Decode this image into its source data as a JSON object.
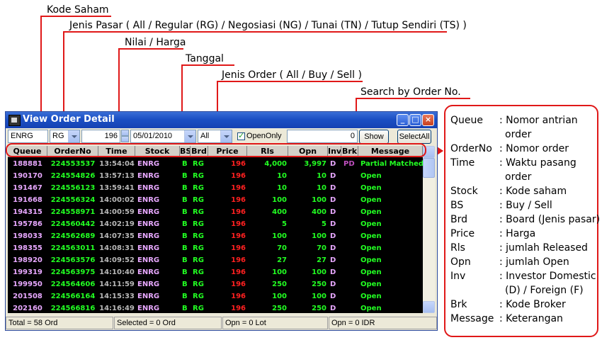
{
  "annotations": {
    "kode_saham": "Kode Saham",
    "jenis_pasar": "Jenis Pasar ( All / Regular (RG) / Negosiasi (NG) / Tunai (TN) / Tutup Sendiri (TS) )",
    "nilai_harga": "Nilai / Harga",
    "tanggal": "Tanggal",
    "jenis_order": "Jenis Order ( All / Buy / Sell )",
    "search_by_order": "Search by Order No."
  },
  "window": {
    "title": "View Order Detail",
    "minimize": "_",
    "maximize": "□",
    "close": "×"
  },
  "toolbar": {
    "stock_value": "ENRG",
    "market_value": "RG",
    "price_value": "196",
    "date_value": "05/01/2010",
    "order_type_value": "All",
    "open_only_label": "OpenOnly",
    "open_only_checked": true,
    "order_no_value": "0",
    "show_label": "Show",
    "select_all_label": "SelectAll"
  },
  "grid": {
    "columns": [
      "Queue",
      "OrderNo",
      "Time",
      "Stock",
      "BS",
      "Brd",
      "Price",
      "Rls",
      "Opn",
      "Inv",
      "Brk",
      "Message"
    ],
    "rows": [
      {
        "queue": "188881",
        "order_no": "224553537",
        "time": "13:54:04",
        "stock": "ENRG",
        "bs": "B",
        "brd": "RG",
        "price": "196",
        "rls": "4,000",
        "opn": "3,997",
        "inv": "D",
        "brk": "PD",
        "message": "Partial Matched"
      },
      {
        "queue": "190170",
        "order_no": "224554826",
        "time": "13:57:13",
        "stock": "ENRG",
        "bs": "B",
        "brd": "RG",
        "price": "196",
        "rls": "10",
        "opn": "10",
        "inv": "D",
        "brk": "",
        "message": "Open"
      },
      {
        "queue": "191467",
        "order_no": "224556123",
        "time": "13:59:41",
        "stock": "ENRG",
        "bs": "B",
        "brd": "RG",
        "price": "196",
        "rls": "10",
        "opn": "10",
        "inv": "D",
        "brk": "",
        "message": "Open"
      },
      {
        "queue": "191668",
        "order_no": "224556324",
        "time": "14:00:02",
        "stock": "ENRG",
        "bs": "B",
        "brd": "RG",
        "price": "196",
        "rls": "100",
        "opn": "100",
        "inv": "D",
        "brk": "",
        "message": "Open"
      },
      {
        "queue": "194315",
        "order_no": "224558971",
        "time": "14:00:59",
        "stock": "ENRG",
        "bs": "B",
        "brd": "RG",
        "price": "196",
        "rls": "400",
        "opn": "400",
        "inv": "D",
        "brk": "",
        "message": "Open"
      },
      {
        "queue": "195786",
        "order_no": "224560442",
        "time": "14:02:19",
        "stock": "ENRG",
        "bs": "B",
        "brd": "RG",
        "price": "196",
        "rls": "5",
        "opn": "5",
        "inv": "D",
        "brk": "",
        "message": "Open"
      },
      {
        "queue": "198033",
        "order_no": "224562689",
        "time": "14:07:35",
        "stock": "ENRG",
        "bs": "B",
        "brd": "RG",
        "price": "196",
        "rls": "100",
        "opn": "100",
        "inv": "D",
        "brk": "",
        "message": "Open"
      },
      {
        "queue": "198355",
        "order_no": "224563011",
        "time": "14:08:31",
        "stock": "ENRG",
        "bs": "B",
        "brd": "RG",
        "price": "196",
        "rls": "70",
        "opn": "70",
        "inv": "D",
        "brk": "",
        "message": "Open"
      },
      {
        "queue": "198920",
        "order_no": "224563576",
        "time": "14:09:52",
        "stock": "ENRG",
        "bs": "B",
        "brd": "RG",
        "price": "196",
        "rls": "27",
        "opn": "27",
        "inv": "D",
        "brk": "",
        "message": "Open"
      },
      {
        "queue": "199319",
        "order_no": "224563975",
        "time": "14:10:40",
        "stock": "ENRG",
        "bs": "B",
        "brd": "RG",
        "price": "196",
        "rls": "100",
        "opn": "100",
        "inv": "D",
        "brk": "",
        "message": "Open"
      },
      {
        "queue": "199950",
        "order_no": "224564606",
        "time": "14:11:59",
        "stock": "ENRG",
        "bs": "B",
        "brd": "RG",
        "price": "196",
        "rls": "250",
        "opn": "250",
        "inv": "D",
        "brk": "",
        "message": "Open"
      },
      {
        "queue": "201508",
        "order_no": "224566164",
        "time": "14:15:33",
        "stock": "ENRG",
        "bs": "B",
        "brd": "RG",
        "price": "196",
        "rls": "100",
        "opn": "100",
        "inv": "D",
        "brk": "",
        "message": "Open"
      },
      {
        "queue": "202160",
        "order_no": "224566816",
        "time": "14:16:49",
        "stock": "ENRG",
        "bs": "B",
        "brd": "RG",
        "price": "196",
        "rls": "250",
        "opn": "250",
        "inv": "D",
        "brk": "",
        "message": "Open"
      }
    ]
  },
  "status": {
    "total": "Total = 58 Ord",
    "selected": "Selected = 0 Ord",
    "opn_lot": "Opn = 0 Lot",
    "opn_idr": "Opn = 0 IDR"
  },
  "legend": [
    {
      "key": "Queue",
      "value": ": Nomor antrian",
      "value2": "order"
    },
    {
      "key": "OrderNo",
      "value": ": Nomor order"
    },
    {
      "key": "Time",
      "value": ": Waktu pasang",
      "value2": "order"
    },
    {
      "key": "Stock",
      "value": ": Kode saham"
    },
    {
      "key": "BS",
      "value": ": Buy / Sell"
    },
    {
      "key": "Brd",
      "value": ": Board (Jenis pasar)"
    },
    {
      "key": "Price",
      "value": ": Harga"
    },
    {
      "key": "Rls",
      "value": ": jumlah Released"
    },
    {
      "key": "Opn",
      "value": ": jumlah Open"
    },
    {
      "key": "Inv",
      "value": ": Investor Domestic",
      "value2": "(D) / Foreign (F)"
    },
    {
      "key": "Brk",
      "value": ": Kode Broker"
    },
    {
      "key": "Message",
      "value": ": Keterangan"
    }
  ],
  "colors": {
    "accent_red": "#e01818",
    "grid_bg": "#000000",
    "text_green": "#22ff22",
    "text_red": "#ff2020",
    "text_violet": "#e8a8ff",
    "text_gray": "#b8b8b8",
    "text_purple": "#c050c0"
  }
}
